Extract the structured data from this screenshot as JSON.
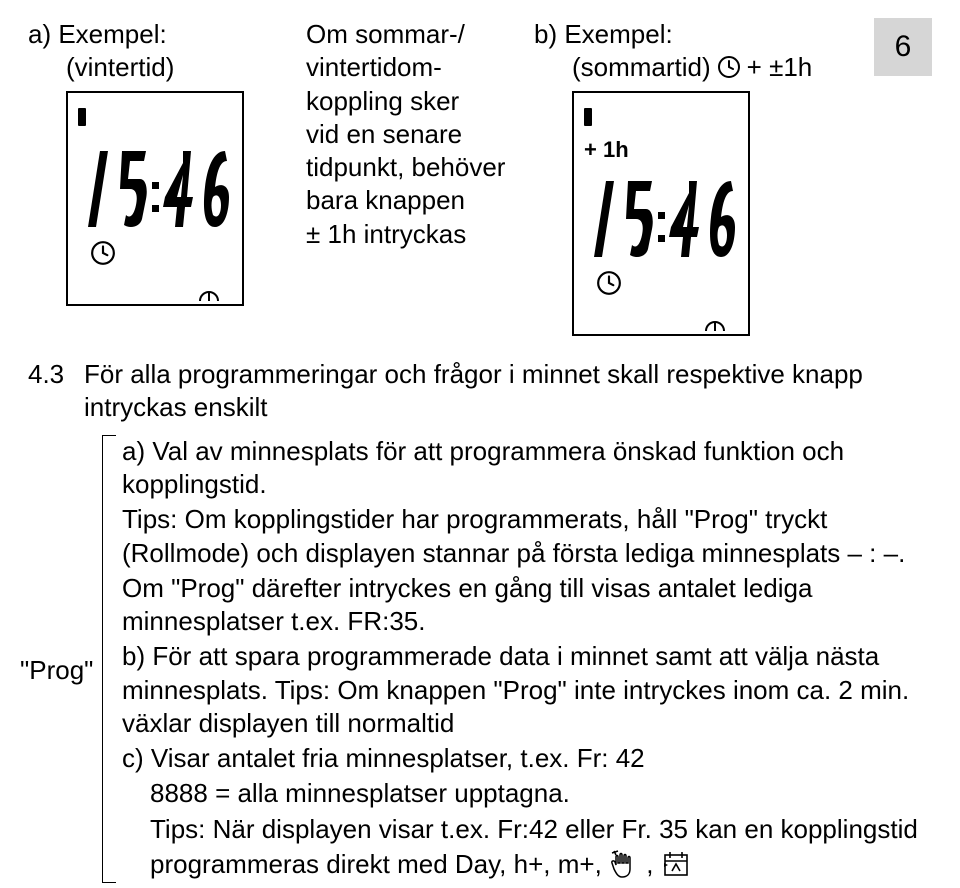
{
  "page_number": "6",
  "exampleA": {
    "heading": "a) Exempel:",
    "sub": "(vintertid)",
    "time": "15:46"
  },
  "middle": {
    "l1": "Om sommar-/",
    "l2": "vintertidom-",
    "l3": "koppling sker",
    "l4": "vid en senare",
    "l5": "tidpunkt, behöver",
    "l6": "bara knappen",
    "l7": "± 1h intryckas"
  },
  "exampleB": {
    "heading": "b) Exempel:",
    "sub": "(sommartid)",
    "suffix": "+ ±1h",
    "plus1h": "+ 1h",
    "time": "15:46"
  },
  "section43": {
    "num": "4.3",
    "text": "För alla programmeringar och frågor i minnet skall respektive knapp intryckas enskilt"
  },
  "prog_label": "\"Prog\"",
  "prog": {
    "a1": "a) Val av minnesplats för att programmera önskad funktion och kopplingstid.",
    "a2": "Tips: Om kopplingstider har programmerats, håll \"Prog\" tryckt (Rollmode) och displayen stannar på första lediga minnesplats – : –.",
    "a3": "Om \"Prog\" därefter intryckes en gång till visas antalet lediga minnesplatser t.ex. FR:35.",
    "b1": "b) För att spara programmerade data i minnet samt att välja nästa minnesplats. Tips: Om knappen \"Prog\" inte intryckes inom ca. 2 min. växlar displayen till normaltid",
    "c1": "c) Visar antalet fria minnesplatser, t.ex. Fr: 42",
    "c2": "8888 = alla minnesplatser upptagna.",
    "c3a": "Tips: När displayen visar t.ex. Fr:42 eller Fr. 35 kan en kopplingstid",
    "c3b": "programmeras direkt med Day, h+, m+, ",
    "c3c": ", "
  }
}
